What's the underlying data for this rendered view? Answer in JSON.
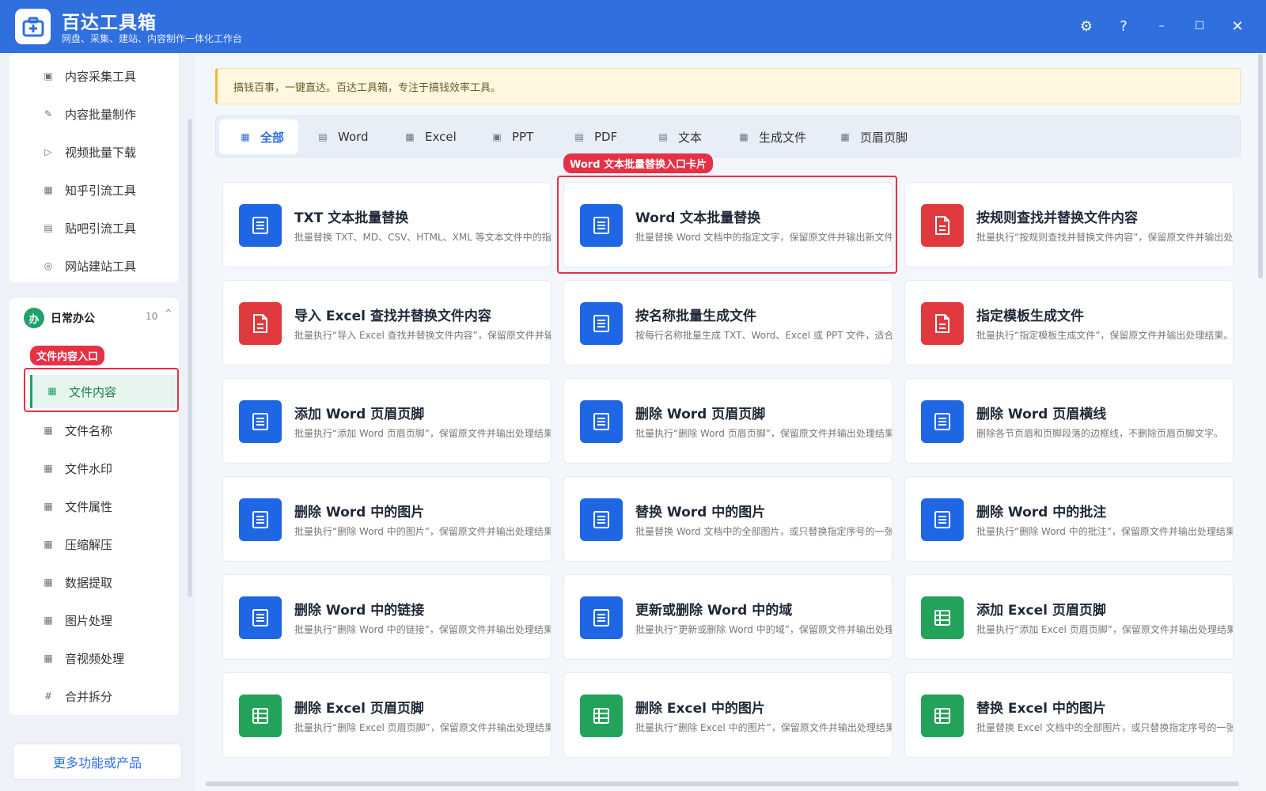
{
  "app": {
    "title": "百达工具箱",
    "subtitle": "网盘、采集、建站、内容制作一体化工作台"
  },
  "sidebar": {
    "top_items": [
      {
        "label": "内容采集工具",
        "icon": "▣"
      },
      {
        "label": "内容批量制作",
        "icon": "✎"
      },
      {
        "label": "视频批量下载",
        "icon": "▷"
      },
      {
        "label": "知乎引流工具",
        "icon": "▦"
      },
      {
        "label": "贴吧引流工具",
        "icon": "▤"
      },
      {
        "label": "网站建站工具",
        "icon": "◎"
      }
    ],
    "group": {
      "badge": "办",
      "title": "日常办公",
      "count": "10",
      "caret": "^"
    },
    "group_items": [
      {
        "label": "文件内容",
        "icon": "▦"
      },
      {
        "label": "文件名称",
        "icon": "▦"
      },
      {
        "label": "文件水印",
        "icon": "▦"
      },
      {
        "label": "文件属性",
        "icon": "▦"
      },
      {
        "label": "压缩解压",
        "icon": "▦"
      },
      {
        "label": "数据提取",
        "icon": "▦"
      },
      {
        "label": "图片处理",
        "icon": "▦"
      },
      {
        "label": "音视频处理",
        "icon": "▦"
      },
      {
        "label": "合并拆分",
        "icon": "#"
      }
    ],
    "highlight_tag": "文件内容入口",
    "more_label": "更多功能或产品"
  },
  "notice": "搞钱百事，一键直达。百达工具箱，专注于搞钱效率工具。",
  "tabs": [
    {
      "label": "全部",
      "active": true
    },
    {
      "label": "Word"
    },
    {
      "label": "Excel"
    },
    {
      "label": "PPT"
    },
    {
      "label": "PDF"
    },
    {
      "label": "文本"
    },
    {
      "label": "生成文件"
    },
    {
      "label": "页眉页脚"
    }
  ],
  "card_highlight_tag": "Word 文本批量替换入口卡片",
  "colors": {
    "blue": "#1f66e5",
    "red": "#e0393e",
    "green": "#23a35a"
  },
  "cards": [
    {
      "title": "TXT 文本批量替换",
      "desc": "批量替换 TXT、MD、CSV、HTML、XML 等文本文件中的指定内容",
      "color": "blue"
    },
    {
      "title": "Word 文本批量替换",
      "desc": "批量替换 Word 文档中的指定文字，保留原文件并输出新文件。",
      "color": "blue"
    },
    {
      "title": "按规则查找并替换文件内容",
      "desc": "批量执行“按规则查找并替换文件内容”，保留原文件并输出处理结果",
      "color": "red"
    },
    {
      "title": "导入 Excel 查找并替换文件内容",
      "desc": "批量执行“导入 Excel 查找并替换文件内容”，保留原文件并输出处理结果",
      "color": "red"
    },
    {
      "title": "按名称批量生成文件",
      "desc": "按每行名称批量生成 TXT、Word、Excel 或 PPT 文件，适合批量建档",
      "color": "blue"
    },
    {
      "title": "指定模板生成文件",
      "desc": "批量执行“指定模板生成文件”，保留原文件并输出处理结果。",
      "color": "red"
    },
    {
      "title": "添加 Word 页眉页脚",
      "desc": "批量执行“添加 Word 页眉页脚”，保留原文件并输出处理结果。",
      "color": "blue"
    },
    {
      "title": "删除 Word 页眉页脚",
      "desc": "批量执行“删除 Word 页眉页脚”，保留原文件并输出处理结果。",
      "color": "blue"
    },
    {
      "title": "删除 Word 页眉横线",
      "desc": "删除各节页眉和页脚段落的边框线，不删除页眉页脚文字。",
      "color": "blue"
    },
    {
      "title": "删除 Word 中的图片",
      "desc": "批量执行“删除 Word 中的图片”，保留原文件并输出处理结果。",
      "color": "blue"
    },
    {
      "title": "替换 Word 中的图片",
      "desc": "批量替换 Word 文档中的全部图片，或只替换指定序号的一张图片。",
      "color": "blue"
    },
    {
      "title": "删除 Word 中的批注",
      "desc": "批量执行“删除 Word 中的批注”，保留原文件并输出处理结果。",
      "color": "blue"
    },
    {
      "title": "删除 Word 中的链接",
      "desc": "批量执行“删除 Word 中的链接”，保留原文件并输出处理结果。",
      "color": "blue"
    },
    {
      "title": "更新或删除 Word 中的域",
      "desc": "批量执行“更新或删除 Word 中的域”，保留原文件并输出处理结果",
      "color": "blue"
    },
    {
      "title": "添加 Excel 页眉页脚",
      "desc": "批量执行“添加 Excel 页眉页脚”，保留原文件并输出处理结果。",
      "color": "green"
    },
    {
      "title": "删除 Excel 页眉页脚",
      "desc": "批量执行“删除 Excel 页眉页脚”，保留原文件并输出处理结果。",
      "color": "green"
    },
    {
      "title": "删除 Excel 中的图片",
      "desc": "批量执行“删除 Excel 中的图片”，保留原文件并输出处理结果。",
      "color": "green"
    },
    {
      "title": "替换 Excel 中的图片",
      "desc": "批量替换 Excel 文档中的全部图片，或只替换指定序号的一张图片。",
      "color": "green"
    }
  ]
}
